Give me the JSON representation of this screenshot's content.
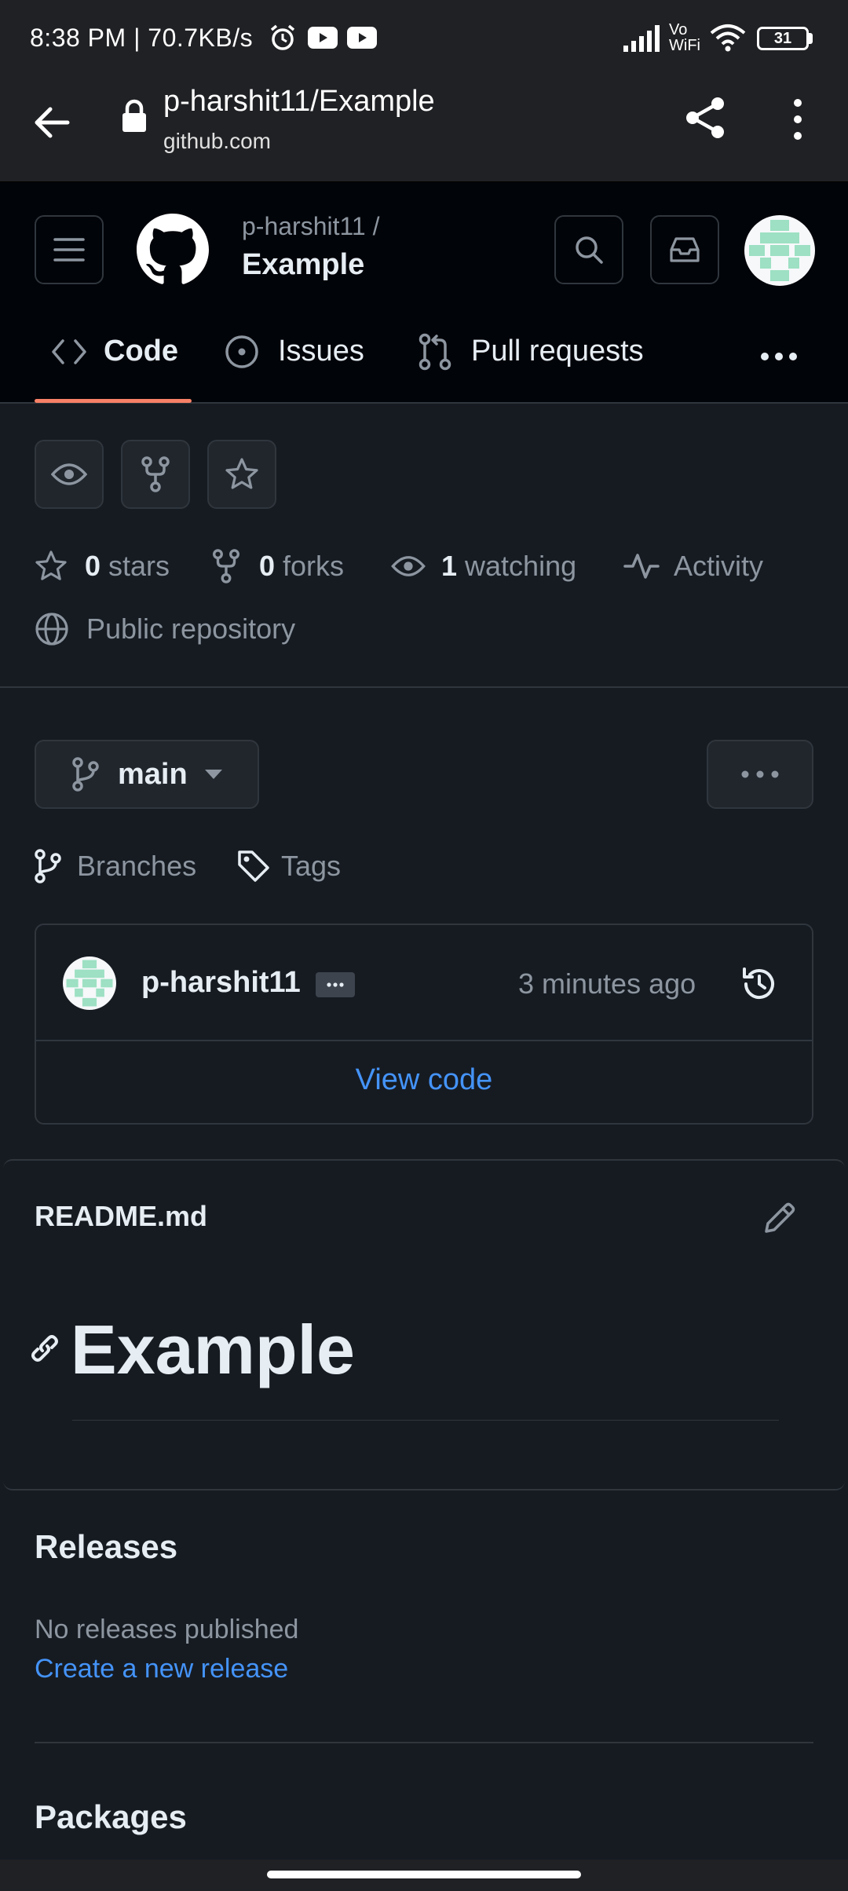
{
  "status_bar": {
    "time": "8:38 PM | 70.7KB/s",
    "network_label": "Vo WiFi",
    "battery": "31"
  },
  "browser": {
    "page_title": "p-harshit11/Example",
    "domain": "github.com"
  },
  "header": {
    "owner": "p-harshit11 /",
    "repo": "Example"
  },
  "tabs": [
    {
      "label": "Code",
      "icon": "code-icon",
      "active": true
    },
    {
      "label": "Issues",
      "icon": "issue-icon",
      "active": false
    },
    {
      "label": "Pull requests",
      "icon": "pull-request-icon",
      "active": false
    }
  ],
  "stats": {
    "stars_count": "0",
    "stars_label": " stars",
    "forks_count": "0",
    "forks_label": " forks",
    "watching_count": "1",
    "watching_label": " watching",
    "activity_label": "Activity",
    "visibility": "Public repository"
  },
  "branch": {
    "name": "main",
    "branches_label": "Branches",
    "tags_label": "Tags"
  },
  "commit": {
    "author": "p-harshit11",
    "time": "3 minutes ago",
    "view_code": "View code"
  },
  "readme": {
    "filename": "README.md",
    "heading": "Example"
  },
  "releases": {
    "title": "Releases",
    "empty": "No releases published",
    "create_link": "Create a new release"
  },
  "packages": {
    "title": "Packages"
  },
  "colors": {
    "accent_tab": "#f78166",
    "link": "#4493f8",
    "avatar": "#9de0c3"
  }
}
